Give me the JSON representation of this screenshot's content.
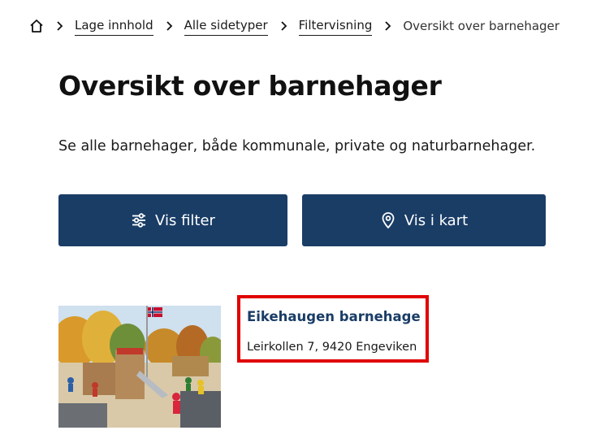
{
  "breadcrumb": {
    "home_icon": "home-icon",
    "items": [
      {
        "label": "Lage innhold"
      },
      {
        "label": "Alle sidetyper"
      },
      {
        "label": "Filtervisning"
      }
    ],
    "current": "Oversikt over barnehager"
  },
  "page": {
    "title": "Oversikt over barnehager",
    "lead": "Se alle barnehager, både kommunale, private og naturbarnehager."
  },
  "buttons": {
    "filter_label": "Vis filter",
    "filter_icon": "sliders-icon",
    "map_label": "Vis i kart",
    "map_icon": "map-pin-icon"
  },
  "results": [
    {
      "name": "Eikehaugen barnehage",
      "address": "Leirkollen 7, 9420 Engeviken",
      "image": "playground-photo"
    }
  ],
  "colors": {
    "button_bg": "#1a3d66",
    "link": "#1a3d66",
    "highlight_border": "#e00000"
  }
}
